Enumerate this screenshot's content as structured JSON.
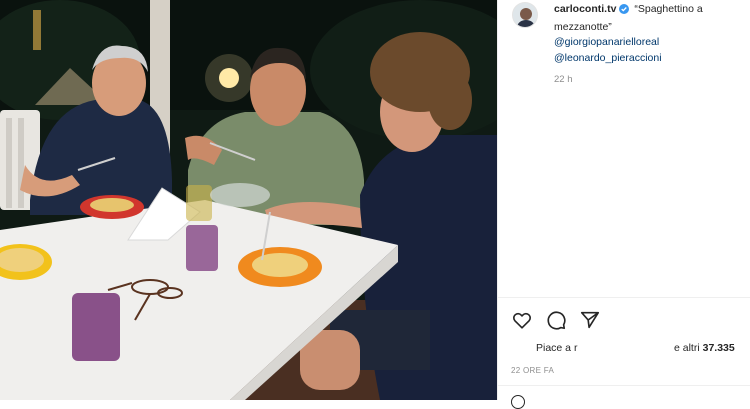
{
  "post": {
    "username": "carloconti.tv",
    "caption_text": "“Spaghettino a mezzanotte”",
    "mentions": [
      "@giorgiopanarielloreal",
      "@leonardo_pieraccioni"
    ],
    "time_ago": "22 h",
    "likes_prefix": "Piace a",
    "likes_cut": "r",
    "likes_others_prefix": "e altri",
    "likes_count": "37.335",
    "date_label": "22 ORE FA"
  },
  "icons": {
    "verified": "verified-badge-icon",
    "like": "heart-icon",
    "comment": "comment-icon",
    "share": "share-icon"
  },
  "colors": {
    "text": "#262626",
    "mention": "#00376b",
    "muted": "#8e8e8e",
    "verified": "#3897f0"
  }
}
